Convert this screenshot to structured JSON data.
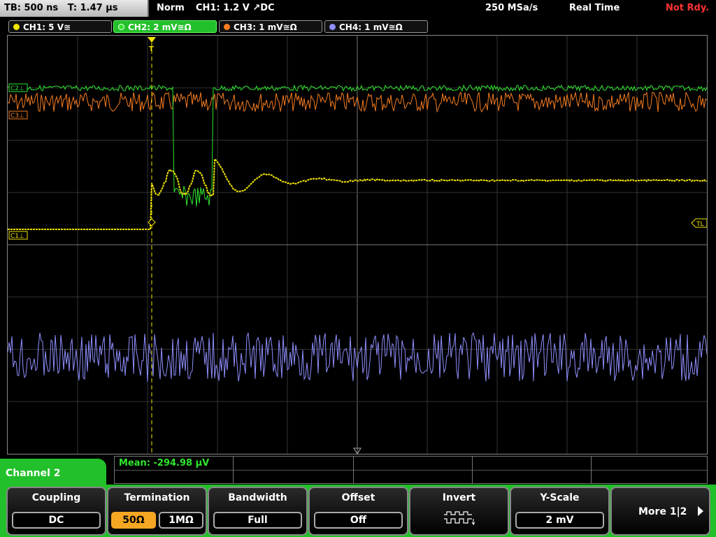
{
  "status": {
    "timebase": "TB: 500 ns",
    "trigger_time": "T: 1.47 µs",
    "mode": "Norm",
    "trigger": "CH1: 1.2 V ↗DC",
    "sample_rate": "250 MSa/s",
    "acq_mode": "Real Time",
    "ready_state": "Not Rdy."
  },
  "channels": [
    {
      "label": "CH1: 5 V≅",
      "color": "#f2e600"
    },
    {
      "label": "CH2: 2 mV≅Ω",
      "color": "#2fe62f"
    },
    {
      "label": "CH3: 1 mV≅Ω",
      "color": "#f57c20"
    },
    {
      "label": "CH4: 1 mV≅Ω",
      "color": "#8f8fff"
    }
  ],
  "markers": {
    "c2": "C2⊥",
    "c3": "C3⊥",
    "c1": "C1⊥",
    "tl": "TL",
    "t": "T"
  },
  "measurement": {
    "mean": "Mean: -294.98 µV"
  },
  "channel_menu": "Channel 2",
  "softkeys": {
    "coupling": {
      "title": "Coupling",
      "value": "DC"
    },
    "termination": {
      "title": "Termination",
      "opt1": "50Ω",
      "opt2": "1MΩ"
    },
    "bandwidth": {
      "title": "Bandwidth",
      "value": "Full"
    },
    "offset": {
      "title": "Offset",
      "value": "Off"
    },
    "invert": {
      "title": "Invert"
    },
    "yscale": {
      "title": "Y-Scale",
      "value": "2 mV"
    },
    "more": "More 1|2"
  }
}
